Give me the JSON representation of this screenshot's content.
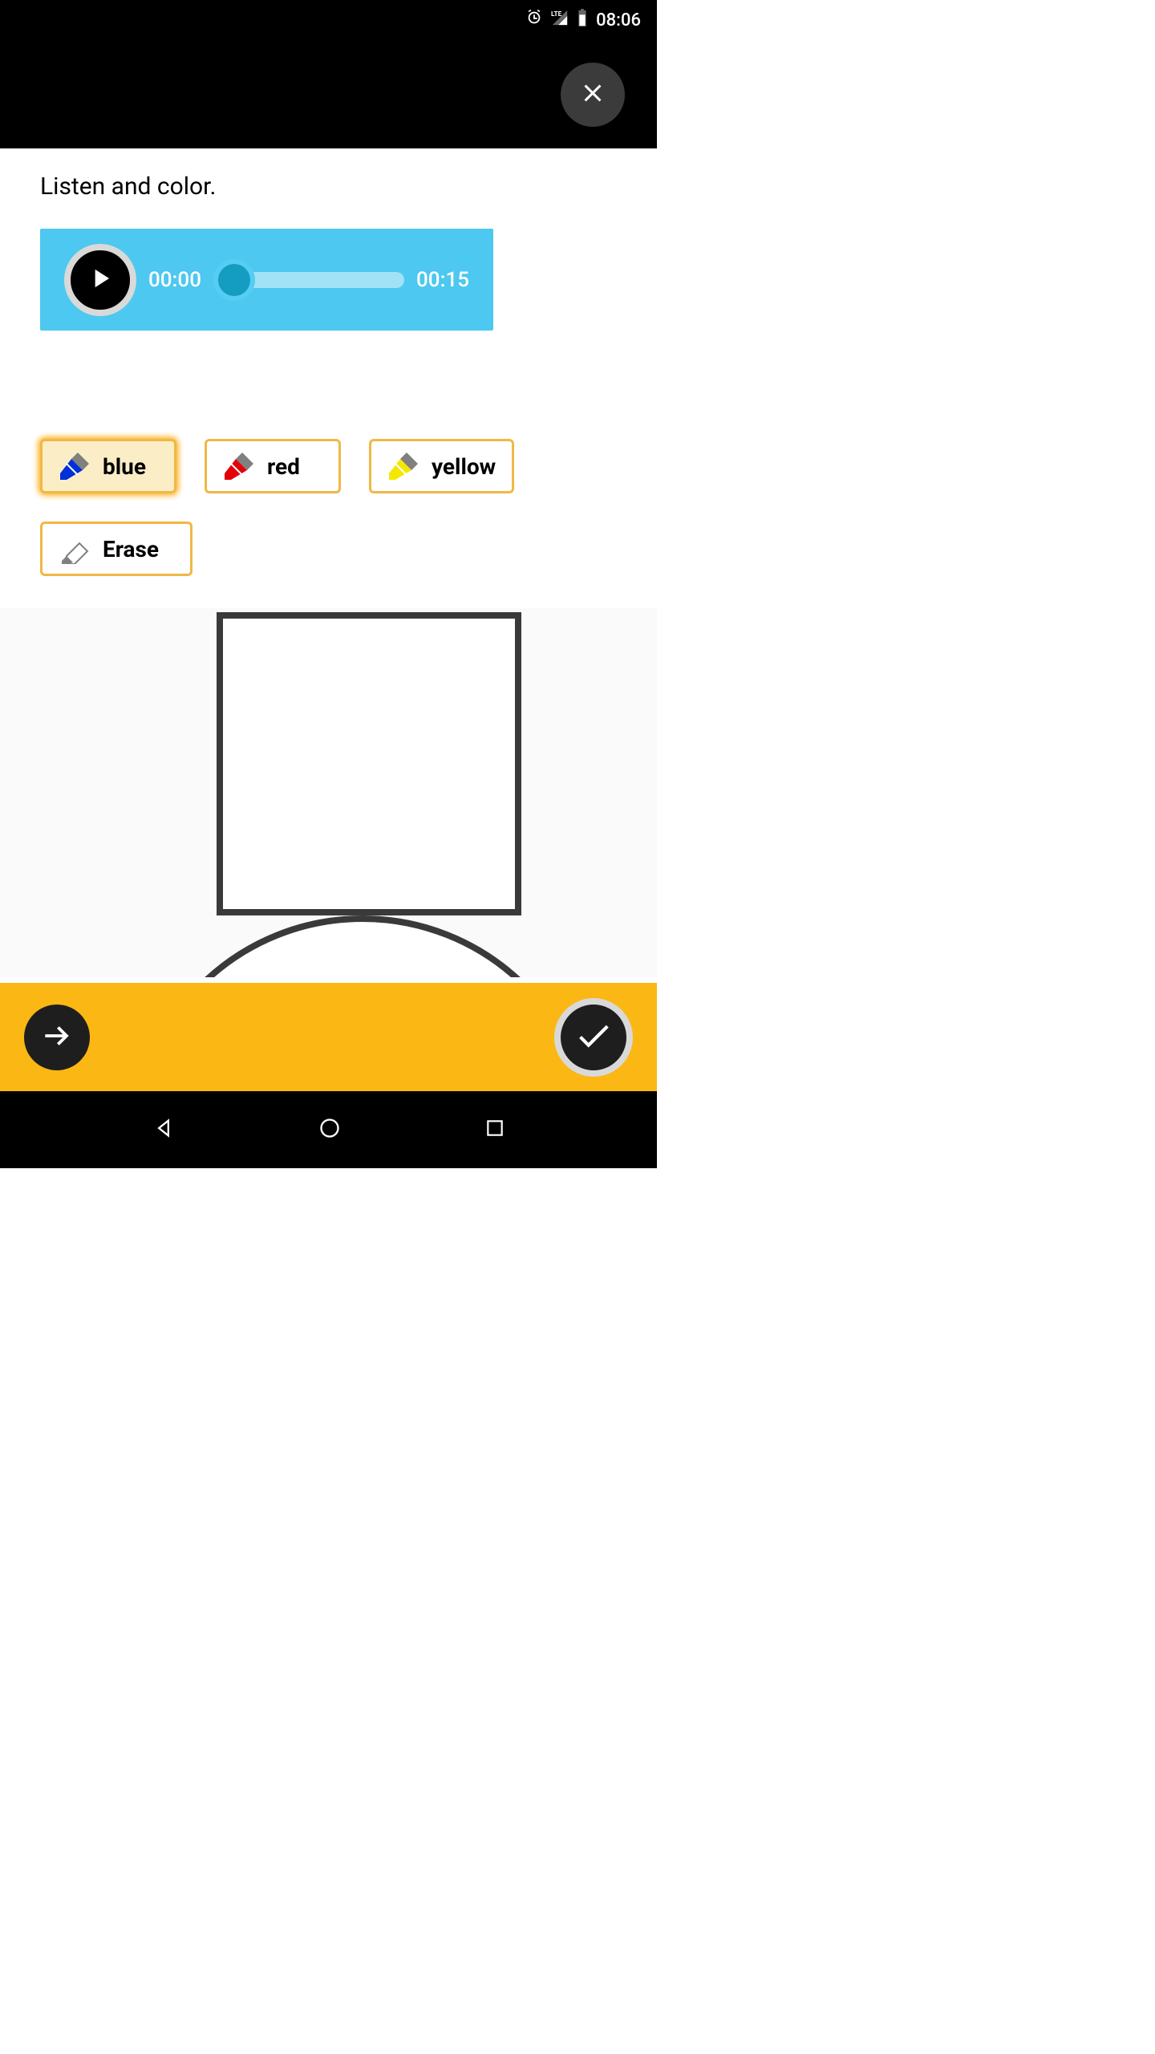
{
  "status_bar": {
    "time": "08:06",
    "network_type": "LTE"
  },
  "instruction": "Listen and color.",
  "audio": {
    "current_time": "00:00",
    "total_time": "00:15",
    "progress": 0
  },
  "tools": [
    {
      "label": "blue",
      "color": "#0030d8",
      "selected": true
    },
    {
      "label": "red",
      "color": "#e30008",
      "selected": false
    },
    {
      "label": "yellow",
      "color": "#f5e800",
      "selected": false
    }
  ],
  "erase_label": "Erase",
  "colors": {
    "accent": "#fbb713",
    "player_bg": "#4dc8f0"
  }
}
